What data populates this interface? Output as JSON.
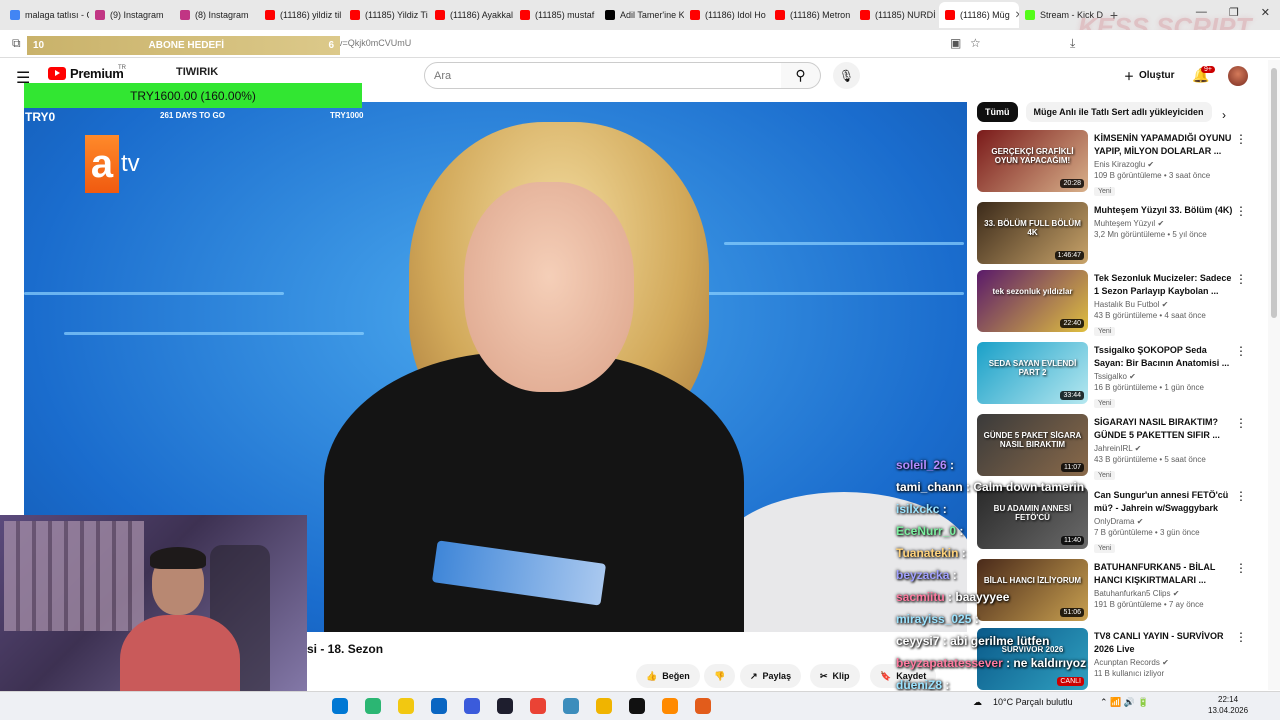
{
  "browser": {
    "tabs": [
      {
        "label": "malaga tatlısı - G",
        "color": "#4285f4"
      },
      {
        "label": "(9) Instagram",
        "color": "#c13584"
      },
      {
        "label": "(8) Instagram",
        "color": "#c13584"
      },
      {
        "label": "(11186) yildiz til",
        "color": "#ff0000"
      },
      {
        "label": "(11185) Yildiz Ti",
        "color": "#ff0000"
      },
      {
        "label": "(11186) Ayakkal",
        "color": "#ff0000"
      },
      {
        "label": "(11185) mustaf",
        "color": "#ff0000"
      },
      {
        "label": "Adil Tamer'ine K",
        "color": "#000000"
      },
      {
        "label": "(11186) Idol Ho",
        "color": "#ff0000"
      },
      {
        "label": "(11186) Metron",
        "color": "#ff0000"
      },
      {
        "label": "(11185) NURDİ",
        "color": "#ff0000"
      },
      {
        "label": "(11186) Müg",
        "color": "#ff0000",
        "active": true
      },
      {
        "label": "Stream - Kick D",
        "color": "#53fc18"
      }
    ],
    "url": "v=Qkjk0mCVUmU",
    "watermark": "KESS SCRIPT"
  },
  "overlay": {
    "goal_left": "10",
    "goal_title": "ABONE HEDEFİ",
    "goal_right": "6",
    "donation_amount": "TRY1600.00 (160.00%)",
    "donation_start": "TRY0",
    "donation_days": "261 DAYS TO GO",
    "donation_target": "TRY1000"
  },
  "youtube": {
    "logo_text": "Premium",
    "logo_region": "TR",
    "channel_tag": "TIWIRIK",
    "search_placeholder": "Ara",
    "create_label": "Oluştur",
    "notification_badge": "9+",
    "video_channel_logo": "atv",
    "video_title": "si - 18. Sezon",
    "actions": {
      "like": "Beğen",
      "share": "Paylaş",
      "clip": "Klip",
      "save": "Kaydet"
    },
    "chips": [
      "Tümü",
      "Müge Anlı ile Tatlı Sert adlı yükleyiciden"
    ],
    "recommendations": [
      {
        "title": "KİMSENİN YAPAMADIĞI OYUNU YAPIP, MİLYON DOLARLAR ...",
        "channel": "Enis Kirazoglu",
        "views": "109 B görüntüleme • 3 saat önce",
        "badge": "Yeni",
        "duration": "20:28",
        "thumb_text": "GERÇEKÇİ GRAFİKLİ OYUN YAPACAĞIM!",
        "color1": "#7a1a1a",
        "color2": "#d8b08a"
      },
      {
        "title": "Muhteşem Yüzyıl 33. Bölüm (4K)",
        "channel": "Muhteşem Yüzyıl",
        "views": "3,2 Mn görüntüleme • 5 yıl önce",
        "badge": "",
        "duration": "1:46:47",
        "thumb_text": "33. BÖLÜM FULL BÖLÜM 4K",
        "color1": "#3b2a1a",
        "color2": "#c9a46a"
      },
      {
        "title": "Tek Sezonluk Mucizeler: Sadece 1 Sezon Parlayıp Kaybolan ...",
        "channel": "Hastalık Bu Futbol",
        "views": "43 B görüntüleme • 4 saat önce",
        "badge": "Yeni",
        "duration": "22:40",
        "thumb_text": "tek sezonluk yıldızlar",
        "color1": "#5a1a6a",
        "color2": "#e0c040"
      },
      {
        "title": "Tssigalko ŞOKOPOP Seda Sayan: Bir Bacının Anatomisi ...",
        "channel": "Tssigalko",
        "views": "16 B görüntüleme • 1 gün önce",
        "badge": "Yeni",
        "duration": "33:44",
        "thumb_text": "SEDA SAYAN EVLENDİ PART 2",
        "color1": "#1aa0c8",
        "color2": "#b6e8f0"
      },
      {
        "title": "SİGARAYI NASIL BIRAKTIM? GÜNDE 5 PAKETTEN SIFIR ...",
        "channel": "JahreinIRL",
        "views": "43 B görüntüleme • 5 saat önce",
        "badge": "Yeni",
        "duration": "11:07",
        "thumb_text": "GÜNDE 5 PAKET SİGARA NASIL BIRAKTIM",
        "color1": "#3a3a3a",
        "color2": "#8a6a4a"
      },
      {
        "title": "Can Sungur'un annesi FETÖ'cü mü? - Jahrein w/Swaggybark",
        "channel": "OnlyDrama",
        "views": "7 B görüntüleme • 3 gün önce",
        "badge": "Yeni",
        "duration": "11:40",
        "thumb_text": "BU ADAMIN ANNESİ FETÖ'CÜ",
        "color1": "#2a2a2a",
        "color2": "#6a6a6a"
      },
      {
        "title": "BATUHANFURKAN5 - BİLAL HANCI KIŞKIRTMALARI ...",
        "channel": "Batuhanfurkan5 Clips",
        "views": "191 B görüntüleme • 7 ay önce",
        "badge": "",
        "duration": "51:06",
        "thumb_text": "BİLAL HANCI İZLİYORUM",
        "color1": "#4a2a1a",
        "color2": "#c8a050"
      },
      {
        "title": "TV8 CANLI YAYIN - SURVİVOR 2026 Live",
        "channel": "Acunptan Records",
        "views": "11 B kullanıcı izliyor",
        "badge": "",
        "duration": "CANLI",
        "thumb_text": "SURVIVOR 2026",
        "color1": "#0a5a8a",
        "color2": "#30a0c0"
      }
    ]
  },
  "chat": [
    {
      "user": "soleil_26",
      "msg": "",
      "color": "#b48cff"
    },
    {
      "user": "tami_chann",
      "msg": "Calm down tamerin",
      "color": "#ffffff"
    },
    {
      "user": "isilxckc",
      "msg": "",
      "color": "#9be3ff"
    },
    {
      "user": "EceNurr_0",
      "msg": "",
      "color": "#7cf0a0"
    },
    {
      "user": "Tuanatekin",
      "msg": "",
      "color": "#ffd27a"
    },
    {
      "user": "beyzacka",
      "msg": "",
      "color": "#a0a0ff"
    },
    {
      "user": "sacmiitu",
      "msg": "baayyyee",
      "color": "#ff7aa0"
    },
    {
      "user": "mirayiss_025",
      "msg": "",
      "color": "#9be3ff"
    },
    {
      "user": "ceyysi7",
      "msg": "abi gerilme lütfen",
      "color": "#ffffff"
    },
    {
      "user": "beyzapatatessever",
      "msg": "ne kaldırıyoz",
      "color": "#ff7aa0"
    },
    {
      "user": "düeniZ8",
      "msg": "",
      "color": "#9be3ff"
    }
  ],
  "taskbar": {
    "weather": "10°C  Parçalı bulutlu",
    "time": "22:14",
    "date": "13.04.2026"
  }
}
